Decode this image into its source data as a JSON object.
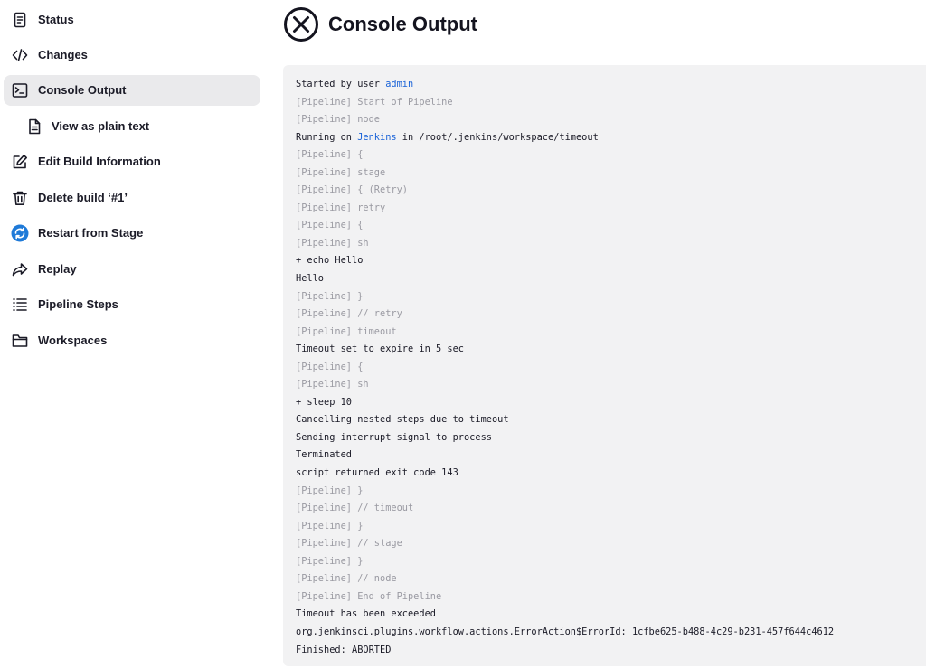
{
  "sidebar": {
    "items": [
      {
        "label": "Status",
        "icon": "status-icon"
      },
      {
        "label": "Changes",
        "icon": "code-icon"
      },
      {
        "label": "Console Output",
        "icon": "terminal-icon",
        "active": true
      },
      {
        "label": "View as plain text",
        "icon": "document-icon"
      },
      {
        "label": "Edit Build Information",
        "icon": "edit-icon"
      },
      {
        "label": "Delete build ‘#1’",
        "icon": "trash-icon"
      },
      {
        "label": "Restart from Stage",
        "icon": "restart-icon"
      },
      {
        "label": "Replay",
        "icon": "replay-icon"
      },
      {
        "label": "Pipeline Steps",
        "icon": "list-icon"
      },
      {
        "label": "Workspaces",
        "icon": "folder-icon"
      }
    ]
  },
  "header": {
    "title": "Console Output",
    "status": "aborted",
    "status_icon": "aborted-x-circle-icon"
  },
  "console": {
    "lines": [
      {
        "parts": [
          {
            "text": "Started by user "
          },
          {
            "text": "admin",
            "link": true
          }
        ]
      },
      {
        "text": "[Pipeline] Start of Pipeline",
        "dim": true
      },
      {
        "text": "[Pipeline] node",
        "dim": true
      },
      {
        "parts": [
          {
            "text": "Running on "
          },
          {
            "text": "Jenkins",
            "link": true
          },
          {
            "text": " in /root/.jenkins/workspace/timeout"
          }
        ]
      },
      {
        "text": "[Pipeline] {",
        "dim": true
      },
      {
        "text": "[Pipeline] stage",
        "dim": true
      },
      {
        "text": "[Pipeline] { (Retry)",
        "dim": true
      },
      {
        "text": "[Pipeline] retry",
        "dim": true
      },
      {
        "text": "[Pipeline] {",
        "dim": true
      },
      {
        "text": "[Pipeline] sh",
        "dim": true
      },
      {
        "text": "+ echo Hello"
      },
      {
        "text": "Hello"
      },
      {
        "text": "[Pipeline] }",
        "dim": true
      },
      {
        "text": "[Pipeline] // retry",
        "dim": true
      },
      {
        "text": "[Pipeline] timeout",
        "dim": true
      },
      {
        "text": "Timeout set to expire in 5 sec"
      },
      {
        "text": "[Pipeline] {",
        "dim": true
      },
      {
        "text": "[Pipeline] sh",
        "dim": true
      },
      {
        "text": "+ sleep 10"
      },
      {
        "text": "Cancelling nested steps due to timeout"
      },
      {
        "text": "Sending interrupt signal to process"
      },
      {
        "text": "Terminated"
      },
      {
        "text": "script returned exit code 143"
      },
      {
        "text": "[Pipeline] }",
        "dim": true
      },
      {
        "text": "[Pipeline] // timeout",
        "dim": true
      },
      {
        "text": "[Pipeline] }",
        "dim": true
      },
      {
        "text": "[Pipeline] // stage",
        "dim": true
      },
      {
        "text": "[Pipeline] }",
        "dim": true
      },
      {
        "text": "[Pipeline] // node",
        "dim": true
      },
      {
        "text": "[Pipeline] End of Pipeline",
        "dim": true
      },
      {
        "text": "Timeout has been exceeded"
      },
      {
        "text": "org.jenkinsci.plugins.workflow.actions.ErrorAction$ErrorId: 1cfbe625-b488-4c29-b231-457f644c4612"
      },
      {
        "text": "Finished: ABORTED"
      }
    ]
  },
  "colors": {
    "link": "#1a63d8",
    "dim_text": "#9a9aa2",
    "console_bg": "#f2f2f3",
    "active_nav_bg": "#eaeaec",
    "restart_icon": "#1f7ad8"
  }
}
